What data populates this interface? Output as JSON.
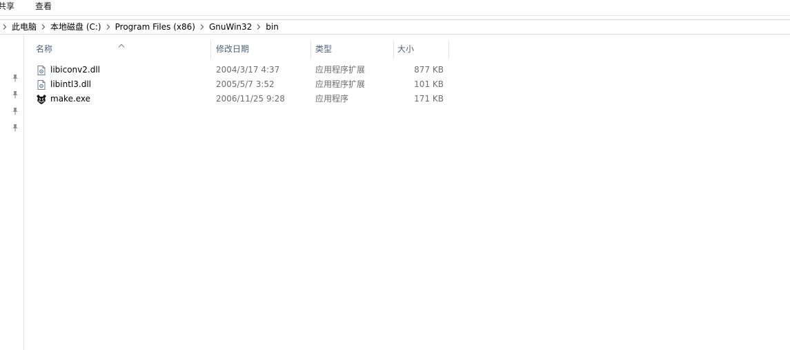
{
  "ribbon": {
    "tabs": [
      {
        "label": "共享"
      },
      {
        "label": "查看"
      }
    ]
  },
  "address": {
    "breadcrumbs": [
      {
        "label": "此电脑"
      },
      {
        "label": "本地磁盘 (C:)"
      },
      {
        "label": "Program Files (x86)"
      },
      {
        "label": "GnuWin32"
      },
      {
        "label": "bin"
      }
    ]
  },
  "columns": {
    "name": "名称",
    "date": "修改日期",
    "type": "类型",
    "size": "大小",
    "sort_indicator": "ascending"
  },
  "files": [
    {
      "name": "libiconv2.dll",
      "date": "2004/3/17 4:37",
      "type": "应用程序扩展",
      "size": "877 KB",
      "icon": "dll-file-icon"
    },
    {
      "name": "libintl3.dll",
      "date": "2005/5/7 3:52",
      "type": "应用程序扩展",
      "size": "101 KB",
      "icon": "dll-file-icon"
    },
    {
      "name": "make.exe",
      "date": "2006/11/25 9:28",
      "type": "应用程序",
      "size": "171 KB",
      "icon": "gnu-exe-icon"
    }
  ],
  "colors": {
    "header_text": "#4c607a",
    "muted_text": "#6d6d6d",
    "divider": "#e6e6e6"
  }
}
